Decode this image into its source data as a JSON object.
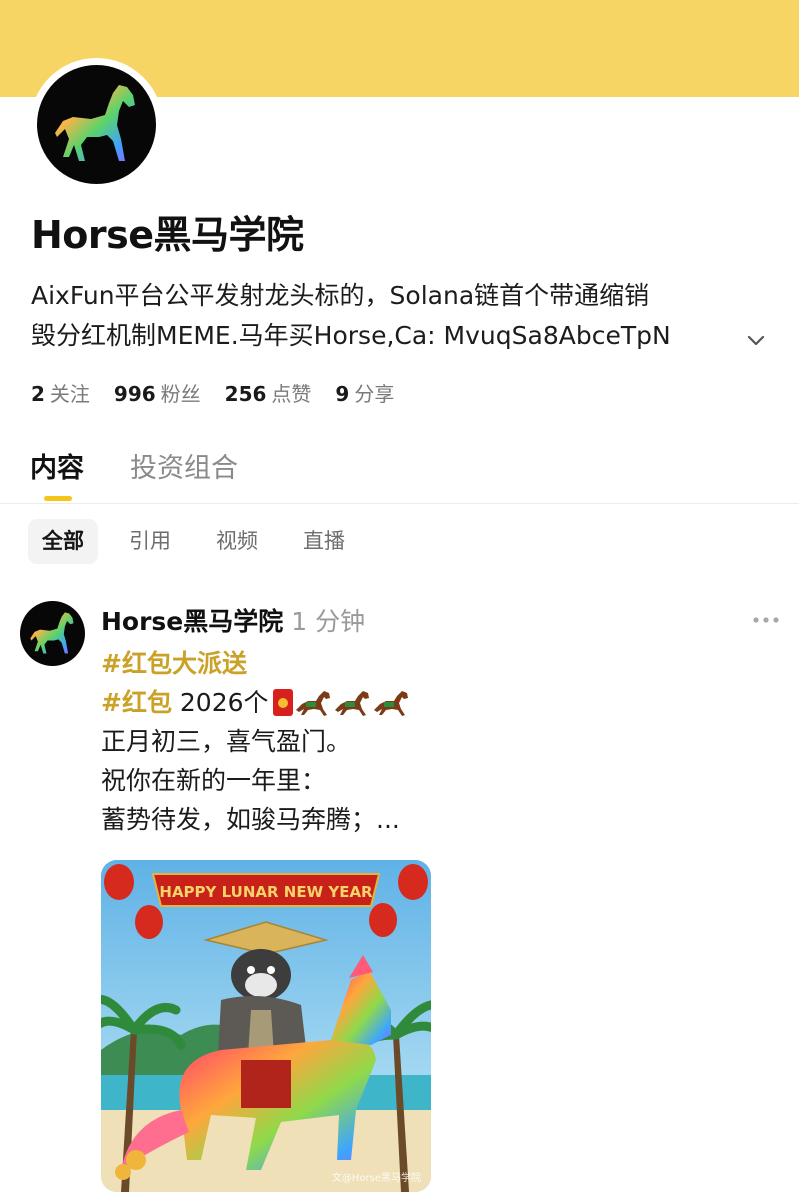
{
  "profile": {
    "name": "Horse黑马学院",
    "bio_line1": "AixFun平台公平发射龙头标的，Solana链首个带通缩销",
    "bio_line2": "毁分红机制MEME.马年买Horse,Ca: MvuqSa8AbceTpN",
    "expand_icon": "chevron-down-icon",
    "avatar_icon": "rainbow-horse-icon",
    "banner_color": "#f7d565",
    "accent_color": "#f5c518"
  },
  "stats": [
    {
      "value": "2",
      "label": "关注"
    },
    {
      "value": "996",
      "label": "粉丝"
    },
    {
      "value": "256",
      "label": "点赞"
    },
    {
      "value": "9",
      "label": "分享"
    }
  ],
  "tabs": [
    {
      "label": "内容",
      "active": true
    },
    {
      "label": "投资组合",
      "active": false
    }
  ],
  "filters": [
    {
      "label": "全部",
      "active": true
    },
    {
      "label": "引用",
      "active": false
    },
    {
      "label": "视频",
      "active": false
    },
    {
      "label": "直播",
      "active": false
    }
  ],
  "post": {
    "author": "Horse黑马学院",
    "time": "1 分钟",
    "more_icon": "more-dots-icon",
    "hashtag1": "#红包大派送",
    "hashtag2": "#红包",
    "count_text": " 2026个",
    "line3": "正月初三，喜气盈门。",
    "line4": "祝你在新的一年里：",
    "line5": "蓄势待发，如骏马奔腾；...",
    "image_banner_text": "HAPPY LUNAR NEW YEAR",
    "image_watermark": "文@Horse黑马学院",
    "hashtag_color": "#c9a227"
  }
}
